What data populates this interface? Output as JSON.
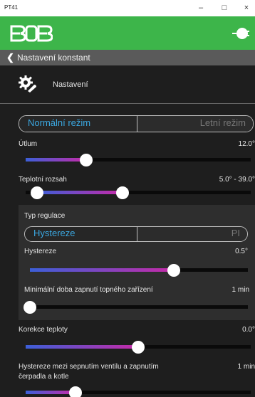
{
  "window": {
    "title": "PT41",
    "minimize": "–",
    "maximize": "□",
    "close": "×"
  },
  "appbar": {
    "logo": "BOB",
    "color": "#3db54a",
    "plug_icon": "plug-icon"
  },
  "nav": {
    "back_glyph": "❮",
    "title": "Nastavení konstant"
  },
  "section": {
    "title": "Nastavení",
    "icon": "gear-wrench-icon"
  },
  "mode": {
    "active": "Normální režim",
    "inactive": "Letní režim"
  },
  "rows": {
    "utlum": {
      "label": "Útlum",
      "value": "12.0°",
      "level": 0.27
    },
    "rozsah": {
      "label": "Teplotní rozsah",
      "value": "5.0° - 39.0°",
      "low_level": 0.05,
      "high_level": 0.43
    },
    "typ": {
      "label": "Typ regulace",
      "active": "Hystereze",
      "inactive": "PI"
    },
    "hystereze": {
      "label": "Hystereze",
      "value": "0.5°",
      "level": 0.66
    },
    "min_doba": {
      "label": "Minimální doba zapnutí topného zařízení",
      "value": "1 min",
      "level": 0.0
    },
    "korekce": {
      "label": "Korekce teploty",
      "value": "0.0°",
      "level": 0.5
    },
    "hystereze_ventil": {
      "label_line1": "Hystereze mezi sepnutím ventilu a zapnutím",
      "label_line2": "čerpadla a kotle",
      "value": "1 min",
      "level": 0.22
    }
  },
  "colors": {
    "accent": "#3ba7e0",
    "gradient_start": "#3c5fd8",
    "gradient_end": "#c62aa8",
    "brand_green": "#3db54a"
  }
}
